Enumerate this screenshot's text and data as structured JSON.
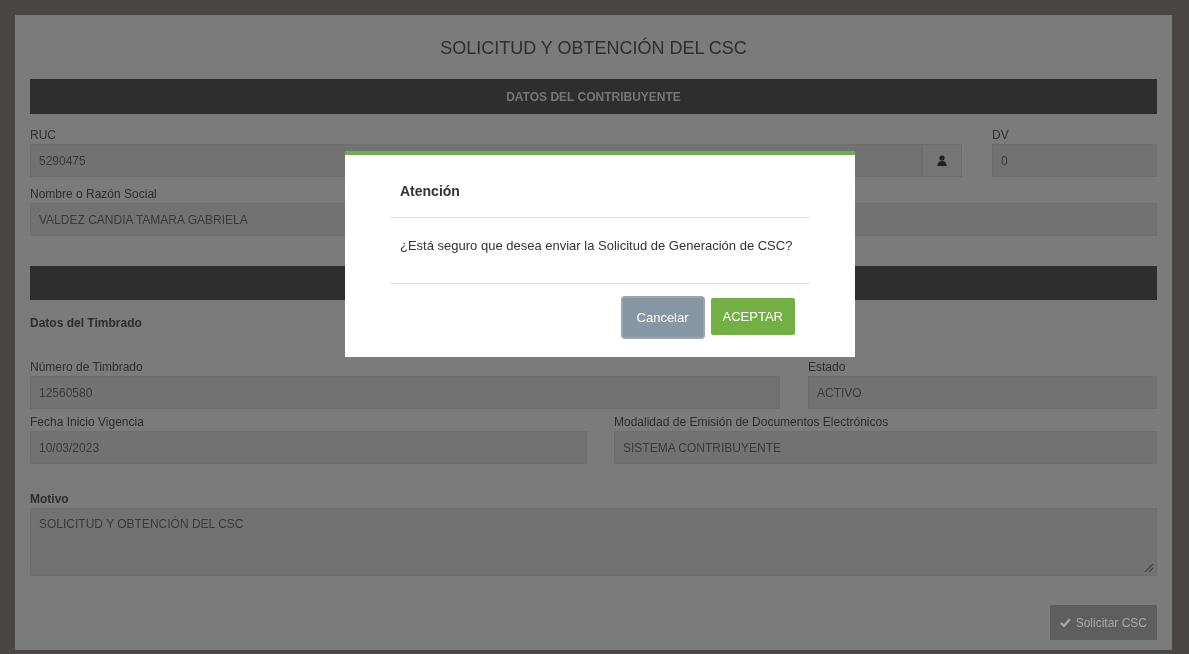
{
  "title": "SOLICITUD Y OBTENCIÓN DEL CSC",
  "contribuyente": {
    "header": "DATOS DEL CONTRIBUYENTE",
    "ruc": {
      "label": "RUC",
      "value": "5290475"
    },
    "dv": {
      "label": "DV",
      "value": "0"
    },
    "nombre": {
      "label": "Nombre o Razón Social",
      "value": "VALDEZ CANDIA TAMARA GABRIELA"
    }
  },
  "timbrado": {
    "subtitle": "Datos del Timbrado",
    "numero": {
      "label": "Número de Timbrado",
      "value": "12560580"
    },
    "estado": {
      "label": "Estado",
      "value": "ACTIVO"
    },
    "fecha": {
      "label": "Fecha Inicio Vigencia",
      "value": "10/03/2023"
    },
    "modalidad": {
      "label": "Modalidad de Emisión de Documentos Electrónicos",
      "value": "SISTEMA CONTRIBUYENTE"
    }
  },
  "motivo": {
    "label": "Motivo",
    "value": "SOLICITUD Y OBTENCIÓN DEL CSC"
  },
  "submit_button": {
    "label": "Solicitar CSC",
    "disabled": true
  },
  "dialog": {
    "title": "Atención",
    "message": "¿Está seguro que desea enviar la Solicitud de Generación de CSC?",
    "buttons": [
      {
        "label": "Cancelar",
        "kind": "secondary"
      },
      {
        "label": "ACEPTAR",
        "kind": "primary"
      }
    ]
  }
}
